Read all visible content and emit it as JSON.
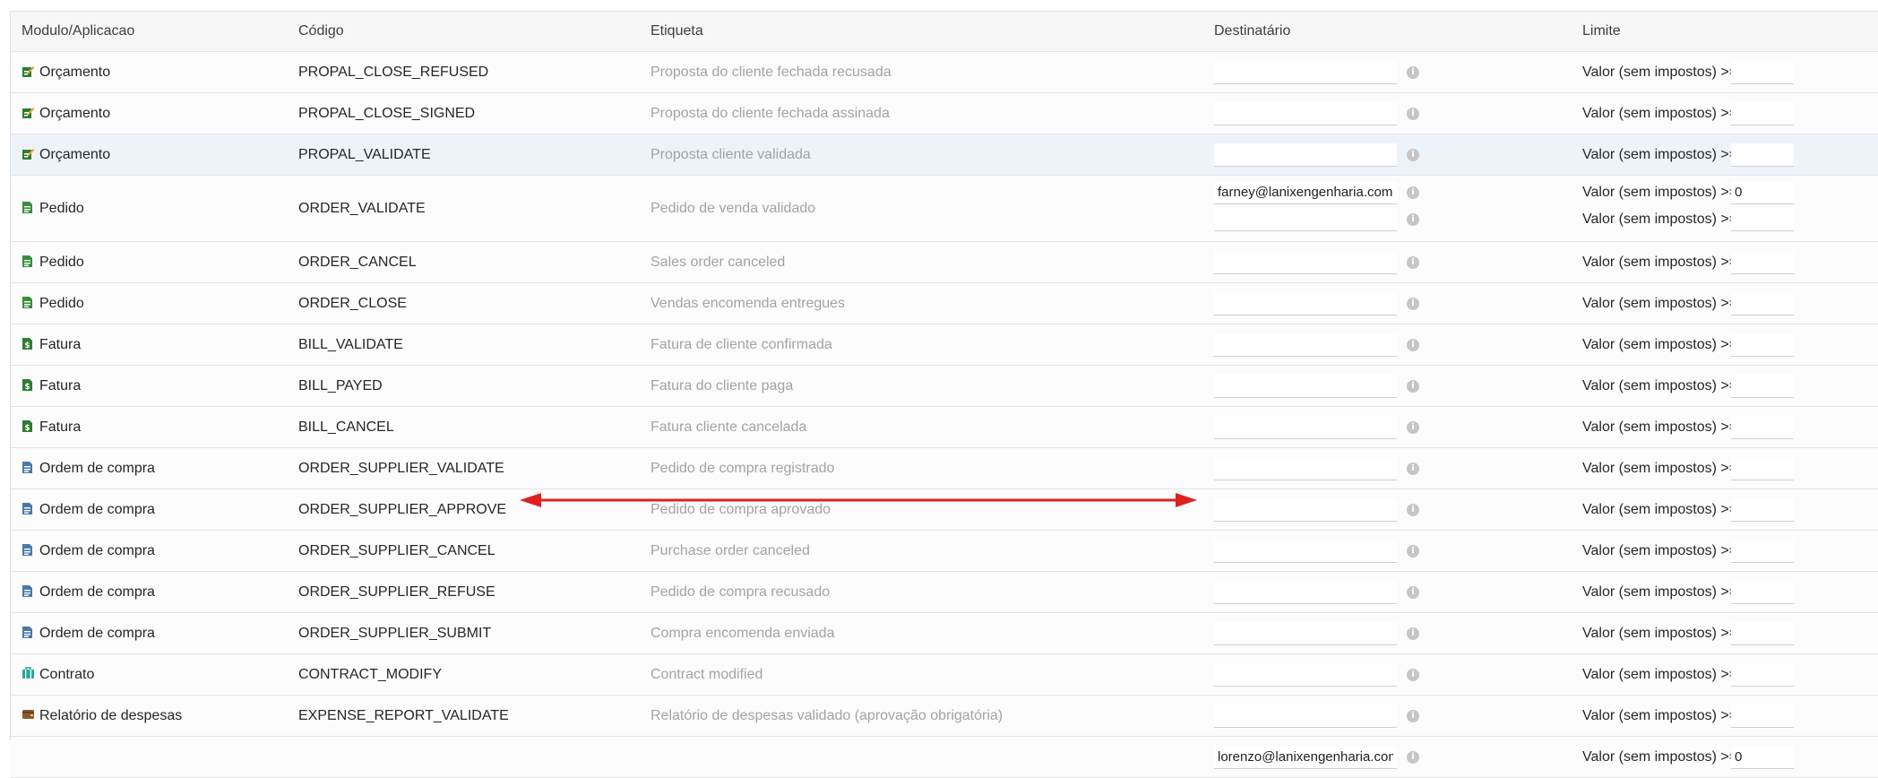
{
  "headers": {
    "module": "Modulo/Aplicacao",
    "code": "Código",
    "label": "Etiqueta",
    "recipient": "Destinatário",
    "limit": "Limite"
  },
  "limit_text": "Valor (sem impostos) >=",
  "info_icon_glyph": "i",
  "icons": {
    "propal": {
      "name": "proposal-icon",
      "color": "#2e7d32"
    },
    "order": {
      "name": "order-document-icon",
      "color": "#388e3c"
    },
    "bill": {
      "name": "invoice-icon",
      "color": "#2e7d32"
    },
    "supplier_order": {
      "name": "supplier-order-icon",
      "color": "#4a78a8"
    },
    "contract": {
      "name": "contract-icon",
      "color": "#27a79c"
    },
    "expense": {
      "name": "wallet-icon",
      "color": "#8b5a2b"
    }
  },
  "rows": [
    {
      "module": "Orçamento",
      "code": "PROPAL_CLOSE_REFUSED",
      "label": "Proposta do cliente fechada recusada",
      "recipients": [
        ""
      ],
      "limits": [
        ""
      ]
    },
    {
      "module": "Orçamento",
      "code": "PROPAL_CLOSE_SIGNED",
      "label": "Proposta do cliente fechada assinada",
      "recipients": [
        ""
      ],
      "limits": [
        ""
      ]
    },
    {
      "module": "Orçamento",
      "code": "PROPAL_VALIDATE",
      "label": "Proposta cliente validada",
      "recipients": [
        ""
      ],
      "limits": [
        ""
      ]
    },
    {
      "module": "Pedido",
      "code": "ORDER_VALIDATE",
      "label": "Pedido de venda validado",
      "recipients": [
        "farney@lanixengenharia.com.br",
        ""
      ],
      "limits": [
        "0",
        ""
      ]
    },
    {
      "module": "Pedido",
      "code": "ORDER_CANCEL",
      "label": "Sales order canceled",
      "recipients": [
        ""
      ],
      "limits": [
        ""
      ]
    },
    {
      "module": "Pedido",
      "code": "ORDER_CLOSE",
      "label": "Vendas encomenda entregues",
      "recipients": [
        ""
      ],
      "limits": [
        ""
      ]
    },
    {
      "module": "Fatura",
      "code": "BILL_VALIDATE",
      "label": "Fatura de cliente confirmada",
      "recipients": [
        ""
      ],
      "limits": [
        ""
      ]
    },
    {
      "module": "Fatura",
      "code": "BILL_PAYED",
      "label": "Fatura do cliente paga",
      "recipients": [
        ""
      ],
      "limits": [
        ""
      ]
    },
    {
      "module": "Fatura",
      "code": "BILL_CANCEL",
      "label": "Fatura cliente cancelada",
      "recipients": [
        ""
      ],
      "limits": [
        ""
      ]
    },
    {
      "module": "Ordem de compra",
      "code": "ORDER_SUPPLIER_VALIDATE",
      "label": "Pedido de compra registrado",
      "recipients": [
        ""
      ],
      "limits": [
        ""
      ]
    },
    {
      "module": "Ordem de compra",
      "code": "ORDER_SUPPLIER_APPROVE",
      "label": "Pedido de compra aprovado",
      "recipients": [
        ""
      ],
      "limits": [
        ""
      ]
    },
    {
      "module": "Ordem de compra",
      "code": "ORDER_SUPPLIER_CANCEL",
      "label": "Purchase order canceled",
      "recipients": [
        ""
      ],
      "limits": [
        ""
      ]
    },
    {
      "module": "Ordem de compra",
      "code": "ORDER_SUPPLIER_REFUSE",
      "label": "Pedido de compra recusado",
      "recipients": [
        ""
      ],
      "limits": [
        ""
      ]
    },
    {
      "module": "Ordem de compra",
      "code": "ORDER_SUPPLIER_SUBMIT",
      "label": "Compra encomenda enviada",
      "recipients": [
        ""
      ],
      "limits": [
        ""
      ]
    },
    {
      "module": "Contrato",
      "code": "CONTRACT_MODIFY",
      "label": "Contract modified",
      "recipients": [
        ""
      ],
      "limits": [
        ""
      ]
    },
    {
      "module": "Relatório de despesas",
      "code": "EXPENSE_REPORT_VALIDATE",
      "label": "Relatório de despesas validado (aprovação obrigatória)",
      "recipients": [
        ""
      ],
      "limits": [
        ""
      ]
    },
    {
      "module": "",
      "code": "",
      "label": "",
      "recipients": [
        "lorenzo@lanixengenharia.com"
      ],
      "limits": [
        "0"
      ]
    }
  ],
  "annotation": {
    "color": "#e02020"
  }
}
